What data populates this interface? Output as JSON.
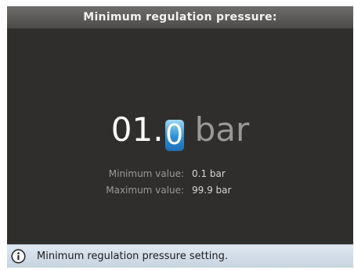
{
  "header": {
    "title": "Minimum regulation pressure:"
  },
  "editor": {
    "fixed_digits": "01.",
    "active_digit": "0",
    "unit": "bar"
  },
  "limits": {
    "min_label": "Minimum value:",
    "min_value": "0.1 bar",
    "max_label": "Maximum value:",
    "max_value": "99.9 bar"
  },
  "infobar": {
    "icon": "info-icon",
    "text": "Minimum regulation pressure setting."
  },
  "colors": {
    "background": "#2f2e2d",
    "cursor_highlight": "#2f8fd6",
    "infobar": "#d6e0ea"
  }
}
